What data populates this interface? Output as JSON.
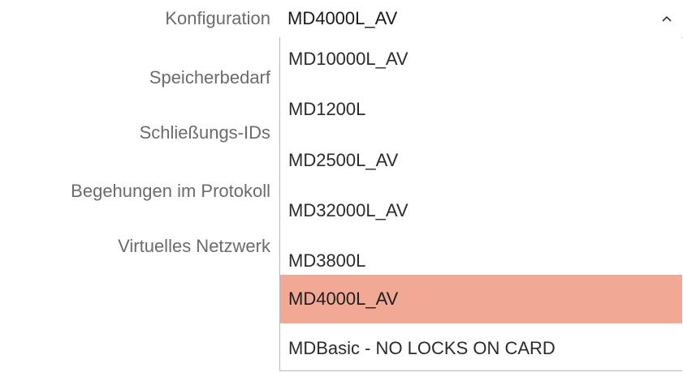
{
  "form": {
    "labels": {
      "konfiguration": "Konfiguration",
      "speicherbedarf": "Speicherbedarf",
      "schliessungs_ids": "Schließungs-IDs",
      "begehungen": "Begehungen im Protokoll",
      "virtuelles_netzwerk": "Virtuelles Netzwerk"
    },
    "config_select": {
      "value": "MD4000L_AV",
      "expanded": true,
      "icon": "chevron-up-icon"
    }
  },
  "dropdown": {
    "options": [
      "MD10000L_AV",
      "MD1200L",
      "MD2500L_AV",
      "MD32000L_AV",
      "MD3800L",
      "MD4000L_AV",
      "MDBasic - NO LOCKS ON CARD"
    ],
    "selected": "MD4000L_AV"
  },
  "colors": {
    "selected_highlight": "#f1a895",
    "label_text": "#6b6b6b",
    "border": "#b8b8b8"
  }
}
